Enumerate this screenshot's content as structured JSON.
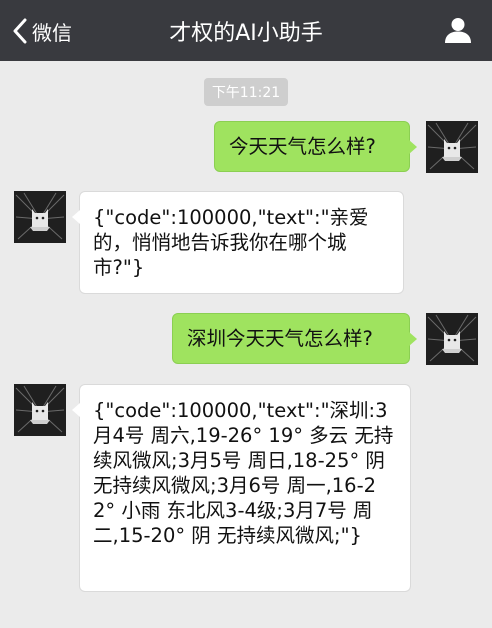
{
  "nav": {
    "back_label": "微信",
    "title": "才权的AI小助手",
    "back_icon": "chevron-left-icon",
    "profile_icon": "person-icon"
  },
  "chat": {
    "timestamp": "下午11:21",
    "messages": [
      {
        "from": "me",
        "text": "今天天气怎么样?"
      },
      {
        "from": "bot",
        "text": "{\"code\":100000,\"text\":\"亲爱的，悄悄地告诉我你在哪个城市?\"}"
      },
      {
        "from": "me",
        "text": "深圳今天天气怎么样?"
      },
      {
        "from": "bot",
        "text": "{\"code\":100000,\"text\":\"深圳:3月4号 周六,19-26° 19° 多云 无持续风微风;3月5号 周日,18-25° 阴 无持续风微风;3月6号 周一,16-22° 小雨 东北风3-4级;3月7号 周二,15-20° 阴 无持续风微风;\"}"
      }
    ]
  },
  "colors": {
    "nav_bg": "#393a3f",
    "chat_bg": "#ebebeb",
    "sent_bubble": "#9fe35f",
    "received_bubble": "#ffffff"
  }
}
